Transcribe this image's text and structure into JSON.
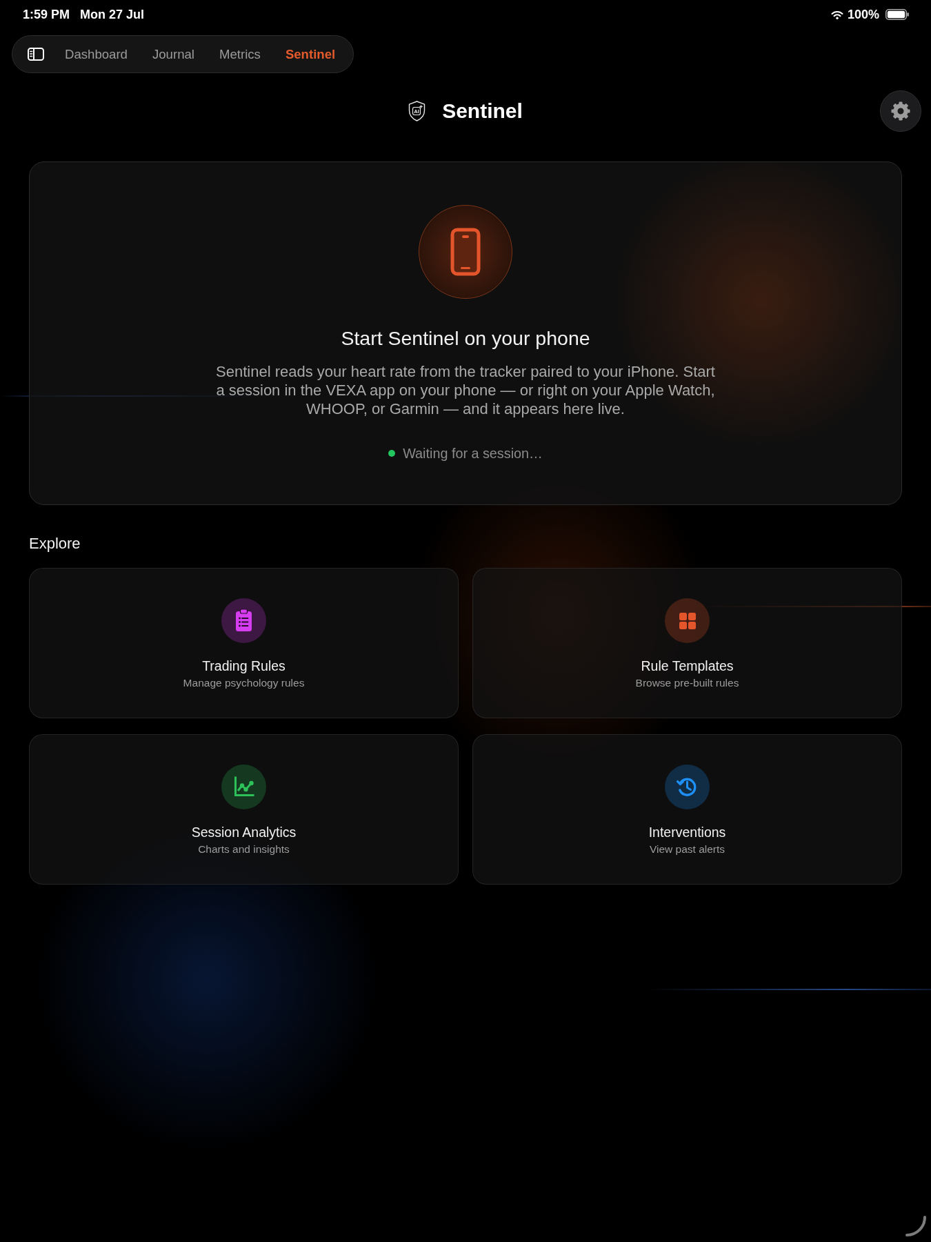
{
  "status_bar": {
    "time": "1:59 PM",
    "date": "Mon 27 Jul",
    "battery": "100%"
  },
  "nav": {
    "tabs": [
      {
        "label": "Dashboard",
        "selected": false
      },
      {
        "label": "Journal",
        "selected": false
      },
      {
        "label": "Metrics",
        "selected": false
      },
      {
        "label": "Sentinel",
        "selected": true
      }
    ]
  },
  "header": {
    "logo_text": "AI",
    "title": "Sentinel"
  },
  "hero": {
    "title": "Start Sentinel on your phone",
    "body": "Sentinel reads your heart rate from the tracker paired to your iPhone. Start a session in the VEXA app on your phone — or right on your Apple Watch, WHOOP, or Garmin — and it appears here live.",
    "status": "Waiting for a session…"
  },
  "explore": {
    "heading": "Explore",
    "cards": [
      {
        "title": "Trading Rules",
        "subtitle": "Manage psychology rules",
        "color": "#d63cf0"
      },
      {
        "title": "Rule Templates",
        "subtitle": "Browse pre-built rules",
        "color": "#e4552b"
      },
      {
        "title": "Session Analytics",
        "subtitle": "Charts and insights",
        "color": "#2ec15a"
      },
      {
        "title": "Interventions",
        "subtitle": "View past alerts",
        "color": "#1e8ff5"
      }
    ]
  }
}
